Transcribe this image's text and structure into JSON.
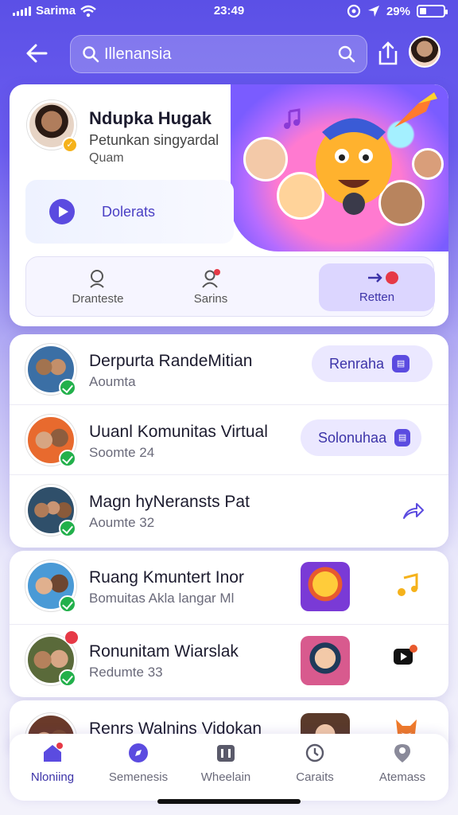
{
  "status_bar": {
    "carrier": "Sarima",
    "time": "23:49",
    "battery": "29%",
    "battery_level": 0.29
  },
  "header": {
    "search_value": "Illenansia"
  },
  "hero": {
    "title": "Ndupka Hugak",
    "subtitle_line1": "Petunkan singyardal",
    "subtitle_line2": "Quam",
    "play_label": "Dolerats",
    "tabs": [
      {
        "label": "Dranteste"
      },
      {
        "label": "Sarins"
      },
      {
        "label": "Retten"
      }
    ]
  },
  "list": [
    {
      "name": "Derpurta RandeMitian",
      "meta": "Aoumta",
      "action": "Renraha"
    },
    {
      "name": "Uuanl Komunitas Virtual",
      "meta": "Soomte 24",
      "action": "Solonuhaa"
    },
    {
      "name": "Magn hyNeransts Pat",
      "meta": "Aoumte 32"
    },
    {
      "name": "Ruang Kmuntert Inor",
      "meta": "Bomuitas Akla langar Ml"
    },
    {
      "name": "Ronunitam Wiarslak",
      "meta": "Redumte 33"
    },
    {
      "name": "Renrs Walnins Vidokan",
      "meta": ""
    }
  ],
  "nav": [
    {
      "label": "Nloniing"
    },
    {
      "label": "Semenesis"
    },
    {
      "label": "Wheelain"
    },
    {
      "label": "Caraits"
    },
    {
      "label": "Atemass"
    }
  ],
  "colors": {
    "accent": "#5b4be0",
    "verified": "#22b04b",
    "badge": "#e63946"
  }
}
